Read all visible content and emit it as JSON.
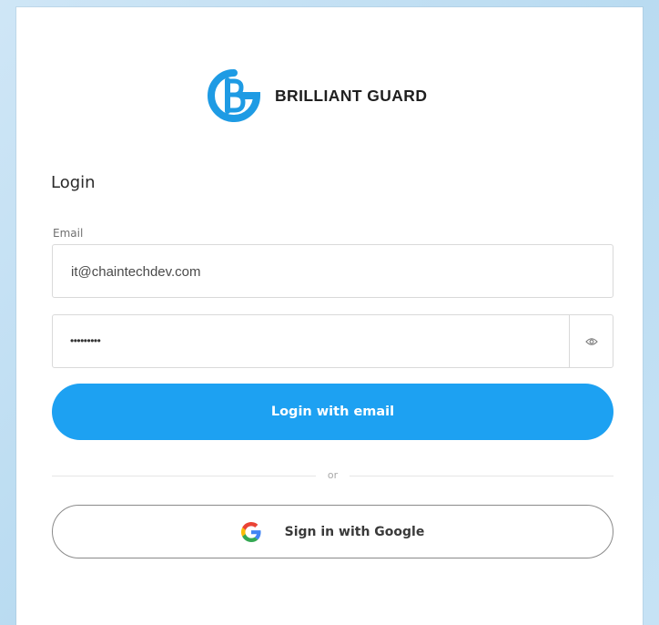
{
  "brand": {
    "name": "BRILLIANT GUARD",
    "logo_icon": "brilliant-guard-logo-icon",
    "logo_color": "#1e9be4"
  },
  "login": {
    "heading": "Login",
    "email_label": "Email",
    "email_value": "it@chaintechdev.com",
    "password_value": "•••••••••",
    "password_toggle_icon": "eye-icon",
    "submit_label": "Login with email",
    "divider_text": "or",
    "google_label": "Sign in with Google",
    "google_icon": "google-icon"
  },
  "colors": {
    "accent": "#1da1f2",
    "background": "#c6e2f5",
    "card": "#ffffff"
  }
}
